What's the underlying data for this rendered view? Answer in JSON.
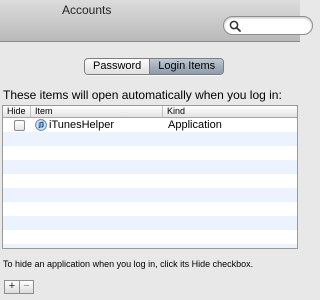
{
  "window": {
    "title": "Accounts"
  },
  "search": {
    "placeholder": "",
    "value": ""
  },
  "tabs": [
    {
      "label": "Password",
      "selected": false
    },
    {
      "label": "Login Items",
      "selected": true
    }
  ],
  "description": "These items will open automatically when you log in:",
  "table": {
    "columns": [
      "Hide",
      "Item",
      "Kind"
    ],
    "rows": [
      {
        "hide_checked": false,
        "item": "iTunesHelper",
        "kind": "Application",
        "icon": "itunes-icon"
      }
    ]
  },
  "hint": "To hide an application when you log in, click its Hide checkbox.",
  "buttons": {
    "add": "+",
    "remove": "−"
  },
  "colors": {
    "selected_tab": "#9aa6b8",
    "alt_row": "#edf3fe"
  }
}
